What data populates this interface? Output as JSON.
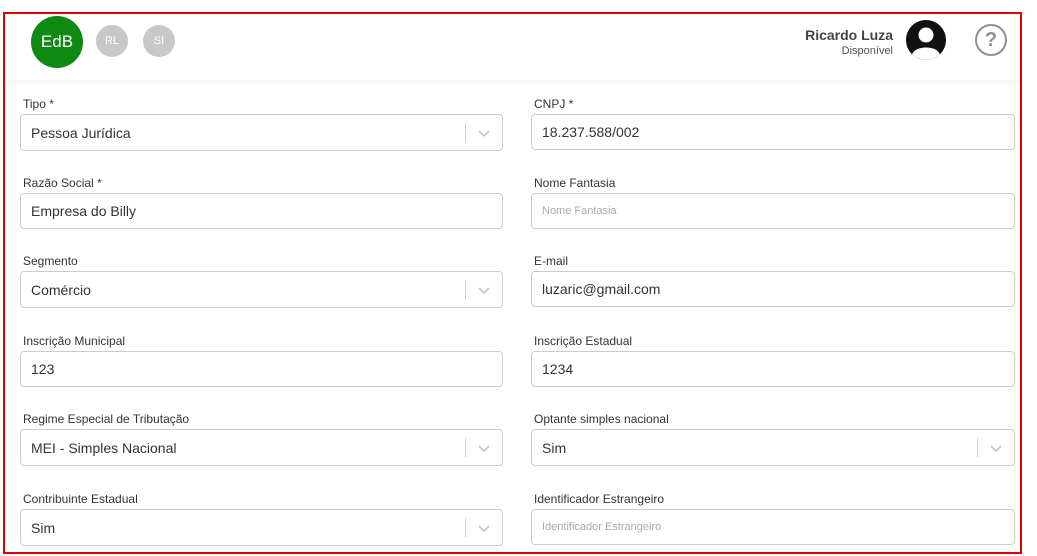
{
  "header": {
    "avatars": [
      "EdB",
      "RL",
      "SI"
    ],
    "user_name": "Ricardo Luza",
    "user_status": "Disponível",
    "help_symbol": "?"
  },
  "form": {
    "tipo": {
      "label": "Tipo *",
      "value": "Pessoa Jurídica"
    },
    "cnpj": {
      "label": "CNPJ *",
      "value": "18.237.588/002"
    },
    "razao_social": {
      "label": "Razão Social *",
      "value": "Empresa do Billy"
    },
    "nome_fantasia": {
      "label": "Nome Fantasia",
      "placeholder": "Nome Fantasia"
    },
    "segmento": {
      "label": "Segmento",
      "value": "Comércio"
    },
    "email": {
      "label": "E-mail",
      "value": "luzaric@gmail.com"
    },
    "inscricao_municipal": {
      "label": "Inscrição Municipal",
      "value": "123"
    },
    "inscricao_estadual": {
      "label": "Inscrição Estadual",
      "value": "1234"
    },
    "regime": {
      "label": "Regime Especial de Tributação",
      "value": "MEI - Simples Nacional"
    },
    "optante": {
      "label": "Optante simples nacional",
      "value": "Sim"
    },
    "contribuinte": {
      "label": "Contribuinte Estadual",
      "value": "Sim"
    },
    "identificador": {
      "label": "Identificador Estrangeiro",
      "placeholder": "Identificador Estrangeiro"
    }
  },
  "colors": {
    "accent": "#0e8a12",
    "frame_border": "#e00000",
    "avatar_gray": "#c8c8c8"
  },
  "icons": {
    "select_arrow": "chevron-down-icon",
    "help": "question-icon",
    "user": "user-avatar-icon"
  }
}
